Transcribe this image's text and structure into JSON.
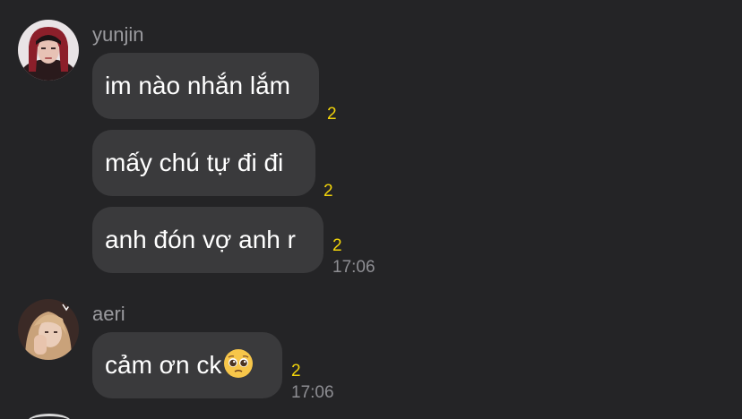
{
  "messages": [
    {
      "sender": "yunjin",
      "avatar_icon": "avatar-yunjin",
      "bubbles": [
        {
          "text": "im nào nhắn lắm",
          "read_count": "2"
        },
        {
          "text": "mấy chú tự đi đi",
          "read_count": "2"
        },
        {
          "text": "anh đón vợ anh r",
          "read_count": "2",
          "time": "17:06"
        }
      ]
    },
    {
      "sender": "aeri",
      "avatar_icon": "avatar-aeri",
      "bubbles": [
        {
          "text": "cảm ơn ck",
          "emoji": "pleading-face-emoji",
          "read_count": "2",
          "time": "17:06"
        }
      ]
    }
  ],
  "colors": {
    "background": "#242426",
    "bubble": "#3a3a3c",
    "unread_count": "#f2d40a",
    "sender_name": "#9a9a9e",
    "timestamp": "#8e8e93"
  }
}
